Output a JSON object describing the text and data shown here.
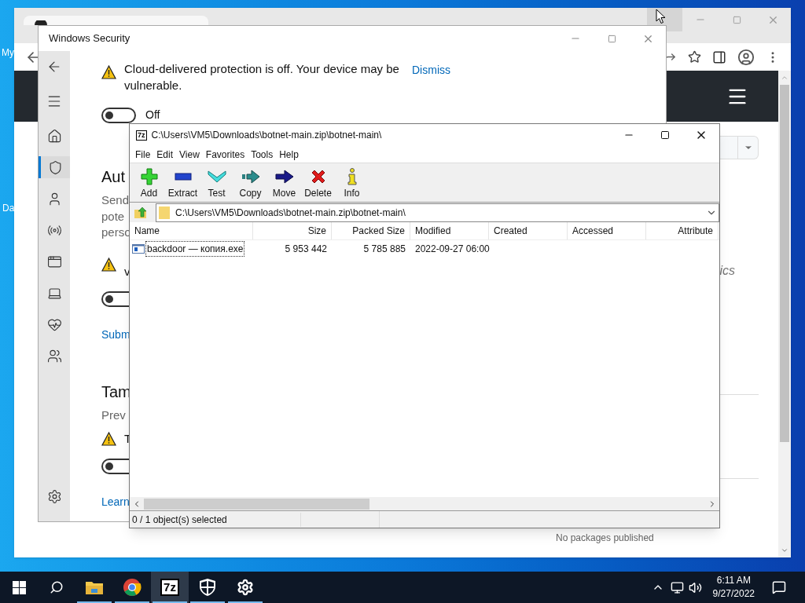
{
  "desktop": {
    "icon_labels": [
      "My",
      "Da"
    ]
  },
  "browser": {
    "fragment": "ics",
    "footer_text": "No packages published"
  },
  "security": {
    "title": "Windows Security",
    "nav": [
      {
        "kind": "home",
        "selected": false
      },
      {
        "kind": "shield",
        "selected": true
      },
      {
        "kind": "account",
        "selected": false
      },
      {
        "kind": "network",
        "selected": false
      },
      {
        "kind": "app",
        "selected": false
      },
      {
        "kind": "device",
        "selected": false
      },
      {
        "kind": "health",
        "selected": false
      },
      {
        "kind": "family",
        "selected": false
      },
      {
        "kind": "settings",
        "selected": false
      }
    ],
    "banner": {
      "message": "Cloud-delivered protection is off. Your device may be vulnerable.",
      "link": "Dismiss"
    },
    "toggle": {
      "on": false,
      "label": "Off"
    },
    "sections": [
      {
        "heading": "Aut",
        "lines": [
          "Send",
          "pote",
          "perso"
        ],
        "warning_lines": [
          "v"
        ],
        "toggle_on": false,
        "link": "Subm"
      },
      {
        "heading": "Tam",
        "lines": [
          "Prev"
        ],
        "warning_lines": [
          "T"
        ],
        "toggle_on": false,
        "link": "Learn"
      }
    ]
  },
  "sevenzip": {
    "logo": "7z",
    "title": "C:\\Users\\VM5\\Downloads\\botnet-main.zip\\botnet-main\\",
    "menu": [
      "File",
      "Edit",
      "View",
      "Favorites",
      "Tools",
      "Help"
    ],
    "toolbar": [
      {
        "kind": "add",
        "label": "Add"
      },
      {
        "kind": "extract",
        "label": "Extract"
      },
      {
        "kind": "test",
        "label": "Test"
      },
      {
        "kind": "copy",
        "label": "Copy"
      },
      {
        "kind": "move",
        "label": "Move"
      },
      {
        "kind": "delete",
        "label": "Delete"
      },
      {
        "kind": "info",
        "label": "Info"
      }
    ],
    "address": "C:\\Users\\VM5\\Downloads\\botnet-main.zip\\botnet-main\\",
    "columns": [
      "Name",
      "Size",
      "Packed Size",
      "Modified",
      "Created",
      "Accessed",
      "Attribute"
    ],
    "rows": [
      {
        "cells": [
          "backdoor — копия.exe",
          "5 953 442",
          "5 785 885",
          "2022-09-27 06:00"
        ],
        "selected": false,
        "focused": true
      }
    ],
    "status": "0 / 1 object(s) selected"
  },
  "taskbar": {
    "apps": [
      {
        "kind": "explorer",
        "running": true,
        "active": false
      },
      {
        "kind": "chrome",
        "running": true,
        "active": false
      },
      {
        "kind": "sevenzip",
        "running": true,
        "active": true,
        "logo": "7z"
      },
      {
        "kind": "security",
        "running": true,
        "active": false
      },
      {
        "kind": "settings",
        "running": true,
        "active": false
      }
    ],
    "time": "6:11 AM",
    "date": "9/27/2022"
  }
}
